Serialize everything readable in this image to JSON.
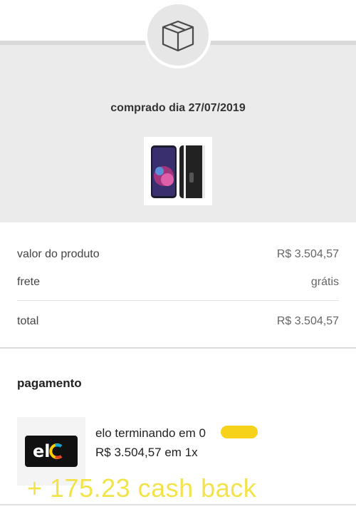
{
  "header": {
    "icon": "package-box-icon",
    "purchase_date": "comprado dia 27/07/2019"
  },
  "product": {
    "image": "phone-product-image"
  },
  "summary": {
    "product_value_label": "valor do produto",
    "product_value": "R$ 3.504,57",
    "shipping_label": "frete",
    "shipping_value": "grátis",
    "total_label": "total",
    "total_value": "R$ 3.504,57"
  },
  "payment": {
    "title": "pagamento",
    "card_brand_icon": "elo-logo-icon",
    "card_line": "elo terminando em 0",
    "installments": "R$ 3.504,57 em 1x"
  },
  "overlay": {
    "cashback_text": "+ 175.23 cash  back",
    "color": "#f3e34a"
  }
}
